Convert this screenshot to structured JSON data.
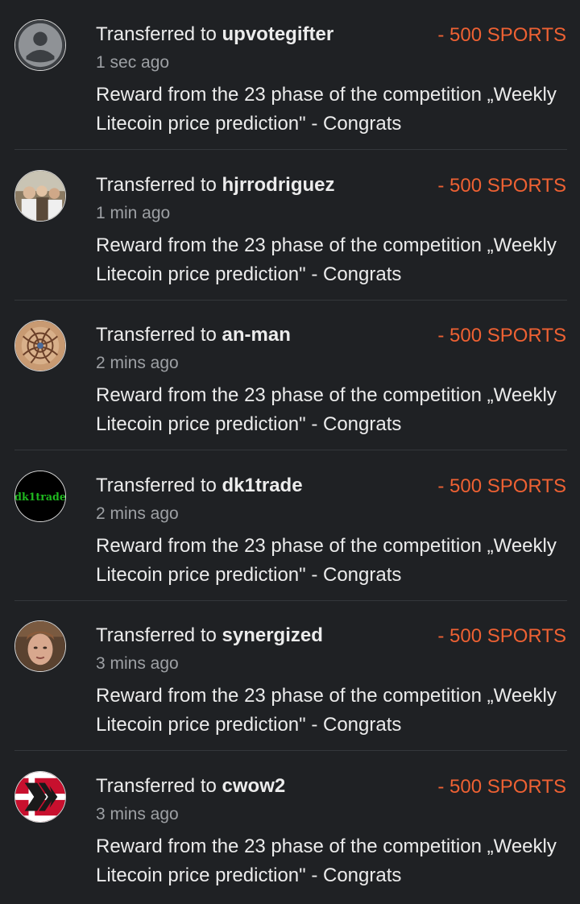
{
  "transfers": [
    {
      "prefix": "Transferred to ",
      "user": "upvotegifter",
      "time": "1 sec ago",
      "amount": "- 500 SPORTS",
      "memo": "Reward from the 23 phase of the competition „Weekly Litecoin price prediction\" - Congrats",
      "avatar_icon": "default-user-icon"
    },
    {
      "prefix": "Transferred to ",
      "user": "hjrrodriguez",
      "time": "1 min ago",
      "amount": "- 500 SPORTS",
      "memo": "Reward from the 23 phase of the competition „Weekly Litecoin price prediction\" - Congrats",
      "avatar_icon": "group-photo"
    },
    {
      "prefix": "Transferred to ",
      "user": "an-man",
      "time": "2 mins ago",
      "amount": "- 500 SPORTS",
      "memo": "Reward from the 23 phase of the competition „Weekly Litecoin price prediction\" - Congrats",
      "avatar_icon": "mandala-art"
    },
    {
      "prefix": "Transferred to ",
      "user": "dk1trade",
      "time": "2 mins ago",
      "amount": "- 500 SPORTS",
      "memo": "Reward from the 23 phase of the competition „Weekly Litecoin price prediction\" - Congrats",
      "avatar_icon": "dk1trade-logo",
      "avatar_text": "dk1trade"
    },
    {
      "prefix": "Transferred to ",
      "user": "synergized",
      "time": "3 mins ago",
      "amount": "- 500 SPORTS",
      "memo": "Reward from the 23 phase of the competition „Weekly Litecoin price prediction\" - Congrats",
      "avatar_icon": "face-photo"
    },
    {
      "prefix": "Transferred to ",
      "user": "cwow2",
      "time": "3 mins ago",
      "amount": "- 500 SPORTS",
      "memo": "Reward from the 23 phase of the competition „Weekly Litecoin price prediction\" - Congrats",
      "avatar_icon": "hive-logo"
    }
  ],
  "colors": {
    "background": "#1f2124",
    "amount": "#ee6133",
    "text": "#ececec",
    "muted": "#9da0a4",
    "divider": "#34373b"
  }
}
